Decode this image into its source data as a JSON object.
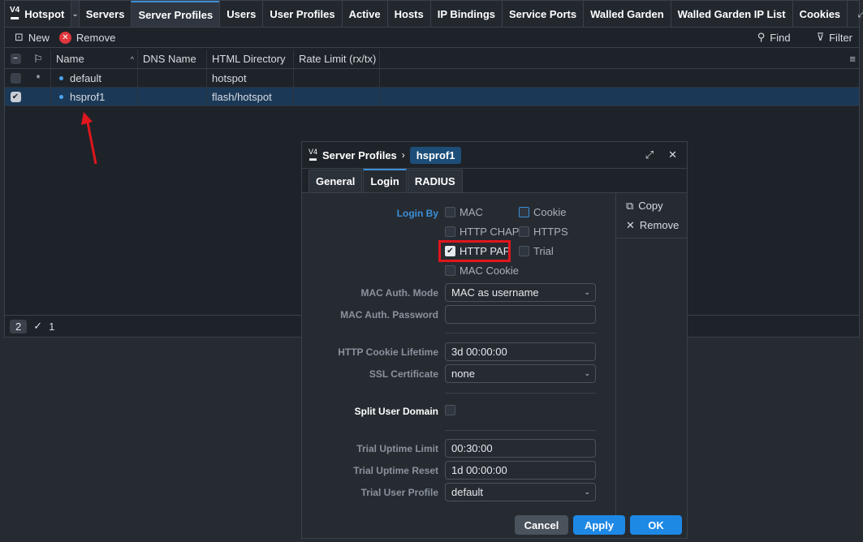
{
  "app": {
    "name": "Hotspot"
  },
  "tabs": [
    "Servers",
    "Server Profiles",
    "Users",
    "User Profiles",
    "Active",
    "Hosts",
    "IP Bindings",
    "Service Ports",
    "Walled Garden",
    "Walled Garden IP List",
    "Cookies"
  ],
  "toolbar": {
    "new_label": "New",
    "remove_label": "Remove",
    "find_label": "Find",
    "filter_label": "Filter"
  },
  "table": {
    "columns": [
      "Name",
      "DNS Name",
      "HTML Directory",
      "Rate Limit (rx/tx)"
    ],
    "rows": [
      {
        "flag": "*",
        "name": "default",
        "dns": "",
        "html_dir": "hotspot",
        "rate": "",
        "selected": false
      },
      {
        "flag": "",
        "name": "hsprof1",
        "dns": "",
        "html_dir": "flash/hotspot",
        "rate": "",
        "selected": true
      }
    ]
  },
  "status": {
    "count": "2",
    "selected_count": "1"
  },
  "dialog": {
    "title": "Server Profiles",
    "crumb": "hsprof1",
    "tabs": [
      "General",
      "Login",
      "RADIUS"
    ],
    "side": {
      "copy_label": "Copy",
      "remove_label": "Remove"
    },
    "login_by_label": "Login By",
    "login_by": {
      "mac": "MAC",
      "cookie": "Cookie",
      "http_chap": "HTTP CHAP",
      "https": "HTTPS",
      "http_pap": "HTTP PAP",
      "trial": "Trial",
      "mac_cookie": "MAC Cookie"
    },
    "fields": {
      "mac_auth_mode_label": "MAC Auth. Mode",
      "mac_auth_mode": "MAC as username",
      "mac_auth_password_label": "MAC Auth. Password",
      "mac_auth_password": "",
      "http_cookie_lifetime_label": "HTTP Cookie Lifetime",
      "http_cookie_lifetime": "3d 00:00:00",
      "ssl_certificate_label": "SSL Certificate",
      "ssl_certificate": "none",
      "split_user_domain_label": "Split User Domain",
      "trial_uptime_limit_label": "Trial Uptime Limit",
      "trial_uptime_limit": "00:30:00",
      "trial_uptime_reset_label": "Trial Uptime Reset",
      "trial_uptime_reset": "1d 00:00:00",
      "trial_user_profile_label": "Trial User Profile",
      "trial_user_profile": "default"
    },
    "buttons": {
      "cancel": "Cancel",
      "apply": "Apply",
      "ok": "OK"
    }
  },
  "colors": {
    "accent": "#1e88e5",
    "annotation": "#e0161d"
  }
}
